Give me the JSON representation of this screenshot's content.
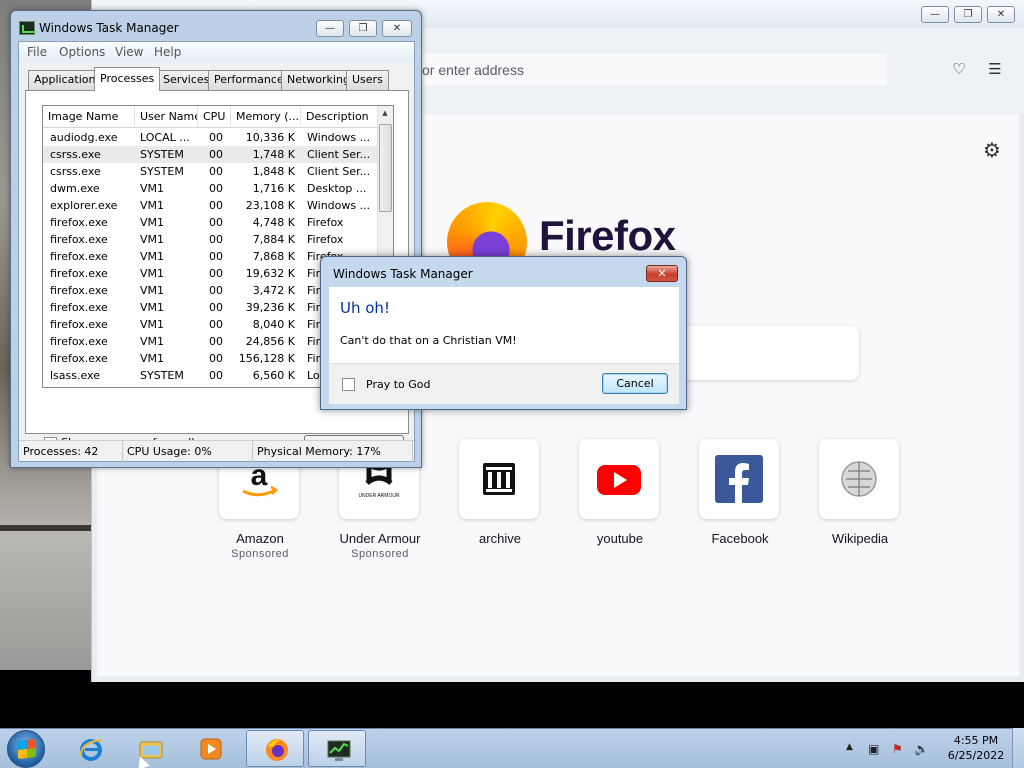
{
  "firefox": {
    "url_placeholder": "or enter address",
    "brand": "Firefox",
    "tiles": [
      {
        "label": "Amazon",
        "sub": "Sponsored",
        "icon": "amazon-icon"
      },
      {
        "label": "Under Armour",
        "sub": "Sponsored",
        "icon": "under-armour-icon"
      },
      {
        "label": "archive",
        "sub": "",
        "icon": "archive-icon"
      },
      {
        "label": "youtube",
        "sub": "",
        "icon": "youtube-icon"
      },
      {
        "label": "Facebook",
        "sub": "",
        "icon": "facebook-icon"
      },
      {
        "label": "Wikipedia",
        "sub": "",
        "icon": "wikipedia-icon"
      }
    ],
    "under_armour_caption": "UNDER ARMOUR"
  },
  "taskmgr": {
    "title": "Windows Task Manager",
    "menu": [
      "File",
      "Options",
      "View",
      "Help"
    ],
    "tabs": [
      "Applications",
      "Processes",
      "Services",
      "Performance",
      "Networking",
      "Users"
    ],
    "active_tab": "Processes",
    "columns": [
      "Image Name",
      "User Name",
      "CPU",
      "Memory (...",
      "Description"
    ],
    "rows": [
      [
        "audiodg.exe",
        "LOCAL ...",
        "00",
        "10,336 K",
        "Windows ..."
      ],
      [
        "csrss.exe",
        "SYSTEM",
        "00",
        "1,748 K",
        "Client Ser..."
      ],
      [
        "csrss.exe",
        "SYSTEM",
        "00",
        "1,848 K",
        "Client Ser..."
      ],
      [
        "dwm.exe",
        "VM1",
        "00",
        "1,716 K",
        "Desktop ..."
      ],
      [
        "explorer.exe",
        "VM1",
        "00",
        "23,108 K",
        "Windows ..."
      ],
      [
        "firefox.exe",
        "VM1",
        "00",
        "4,748 K",
        "Firefox"
      ],
      [
        "firefox.exe",
        "VM1",
        "00",
        "7,884 K",
        "Firefox"
      ],
      [
        "firefox.exe",
        "VM1",
        "00",
        "7,868 K",
        "Firefox"
      ],
      [
        "firefox.exe",
        "VM1",
        "00",
        "19,632 K",
        "Fire"
      ],
      [
        "firefox.exe",
        "VM1",
        "00",
        "3,472 K",
        "Fire"
      ],
      [
        "firefox.exe",
        "VM1",
        "00",
        "39,236 K",
        "Fire"
      ],
      [
        "firefox.exe",
        "VM1",
        "00",
        "8,040 K",
        "Fire"
      ],
      [
        "firefox.exe",
        "VM1",
        "00",
        "24,856 K",
        "Fire"
      ],
      [
        "firefox.exe",
        "VM1",
        "00",
        "156,128 K",
        "Fire"
      ],
      [
        "lsass.exe",
        "SYSTEM",
        "00",
        "6,560 K",
        "Loc"
      ]
    ],
    "selected_row": 1,
    "show_all_label": "Show processes from all users",
    "show_all_checked": true,
    "end_process_label": "E",
    "status": {
      "processes": "Processes: 42",
      "cpu": "CPU Usage: 0%",
      "memory": "Physical Memory: 17%"
    }
  },
  "dialog": {
    "title": "Windows Task Manager",
    "heading": "Uh oh!",
    "message": "Can't do that on a Christian VM!",
    "checkbox_label": "Pray to God",
    "checkbox_checked": false,
    "cancel_label": "Cancel"
  },
  "taskbar": {
    "time": "4:55 PM",
    "date": "6/25/2022",
    "pinned": [
      "internet-explorer-icon",
      "file-explorer-icon",
      "media-player-icon",
      "firefox-icon",
      "task-manager-icon"
    ]
  },
  "colors": {
    "firefox_bg": "#f9f9fb",
    "dialog_heading": "#003399",
    "youtube_red": "#ff0000",
    "facebook_blue": "#1877f2"
  }
}
